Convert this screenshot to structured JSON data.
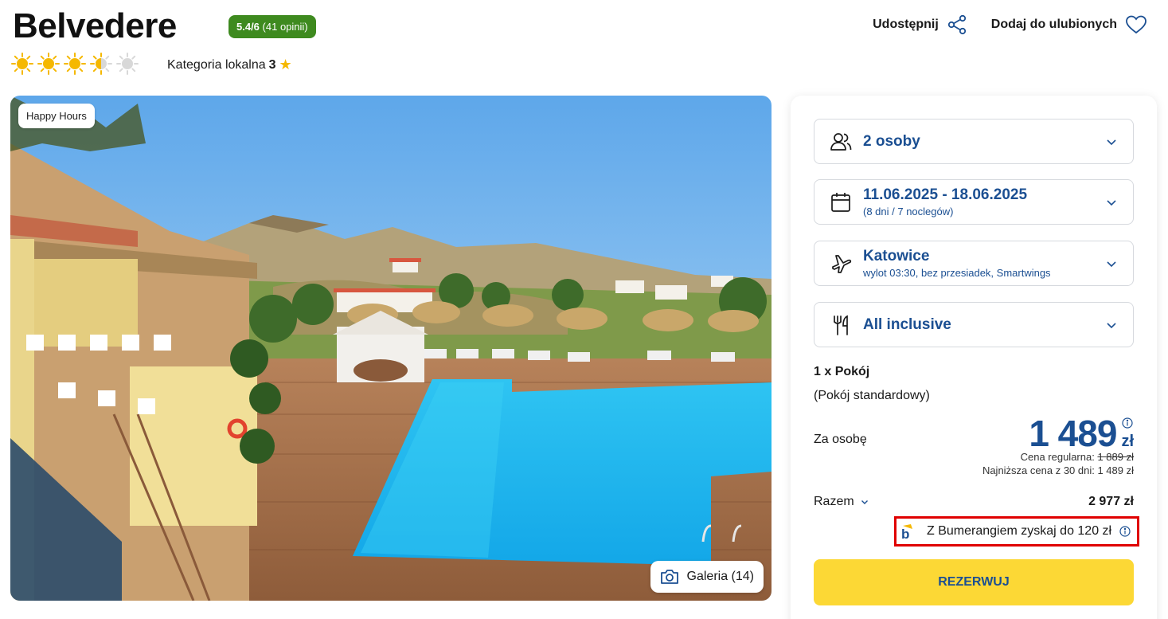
{
  "hotel": {
    "name": "Belvedere",
    "rating_score": "5.4/6",
    "rating_reviews": "(41 opinii)",
    "sun_rating": 3.5,
    "category_label": "Kategoria lokalna",
    "category_value": "3"
  },
  "actions": {
    "share_label": "Udostępnij",
    "favorite_label": "Dodaj do ulubionych"
  },
  "hero": {
    "badge": "Happy Hours",
    "gallery_label": "Galeria (14)"
  },
  "booking": {
    "guests": "2 osoby",
    "dates": "11.06.2025 - 18.06.2025",
    "dates_sub": "(8 dni / 7 noclegów)",
    "departure": "Katowice",
    "departure_sub": "wylot 03:30, bez przesiadek, Smartwings",
    "board": "All inclusive",
    "room_count": "1 x Pokój",
    "room_type": "(Pokój standardowy)",
    "per_person_label": "Za osobę",
    "price_amount": "1 489",
    "price_currency": "zł",
    "regular_label": "Cena regularna:",
    "regular_price": "1 889 zł",
    "lowest_text": "Najniższa cena z 30 dni: 1 489 zł",
    "total_label": "Razem",
    "total_value": "2 977 zł",
    "bumerang_text": "Z Bumerangiem zyskaj do 120 zł",
    "reserve_label": "REZERWUJ"
  },
  "colors": {
    "brand_blue": "#1b4f92",
    "rating_green": "#3e8a1f",
    "reserve_yellow": "#fcd835",
    "sun_yellow": "#f5b800",
    "highlight_red": "#e00000"
  },
  "icons": [
    "sun-icon",
    "star-icon",
    "share-icon",
    "heart-icon",
    "camera-icon",
    "users-icon",
    "calendar-icon",
    "plane-icon",
    "cutlery-icon",
    "chevron-down-icon",
    "info-icon",
    "bumerang-logo-icon"
  ]
}
